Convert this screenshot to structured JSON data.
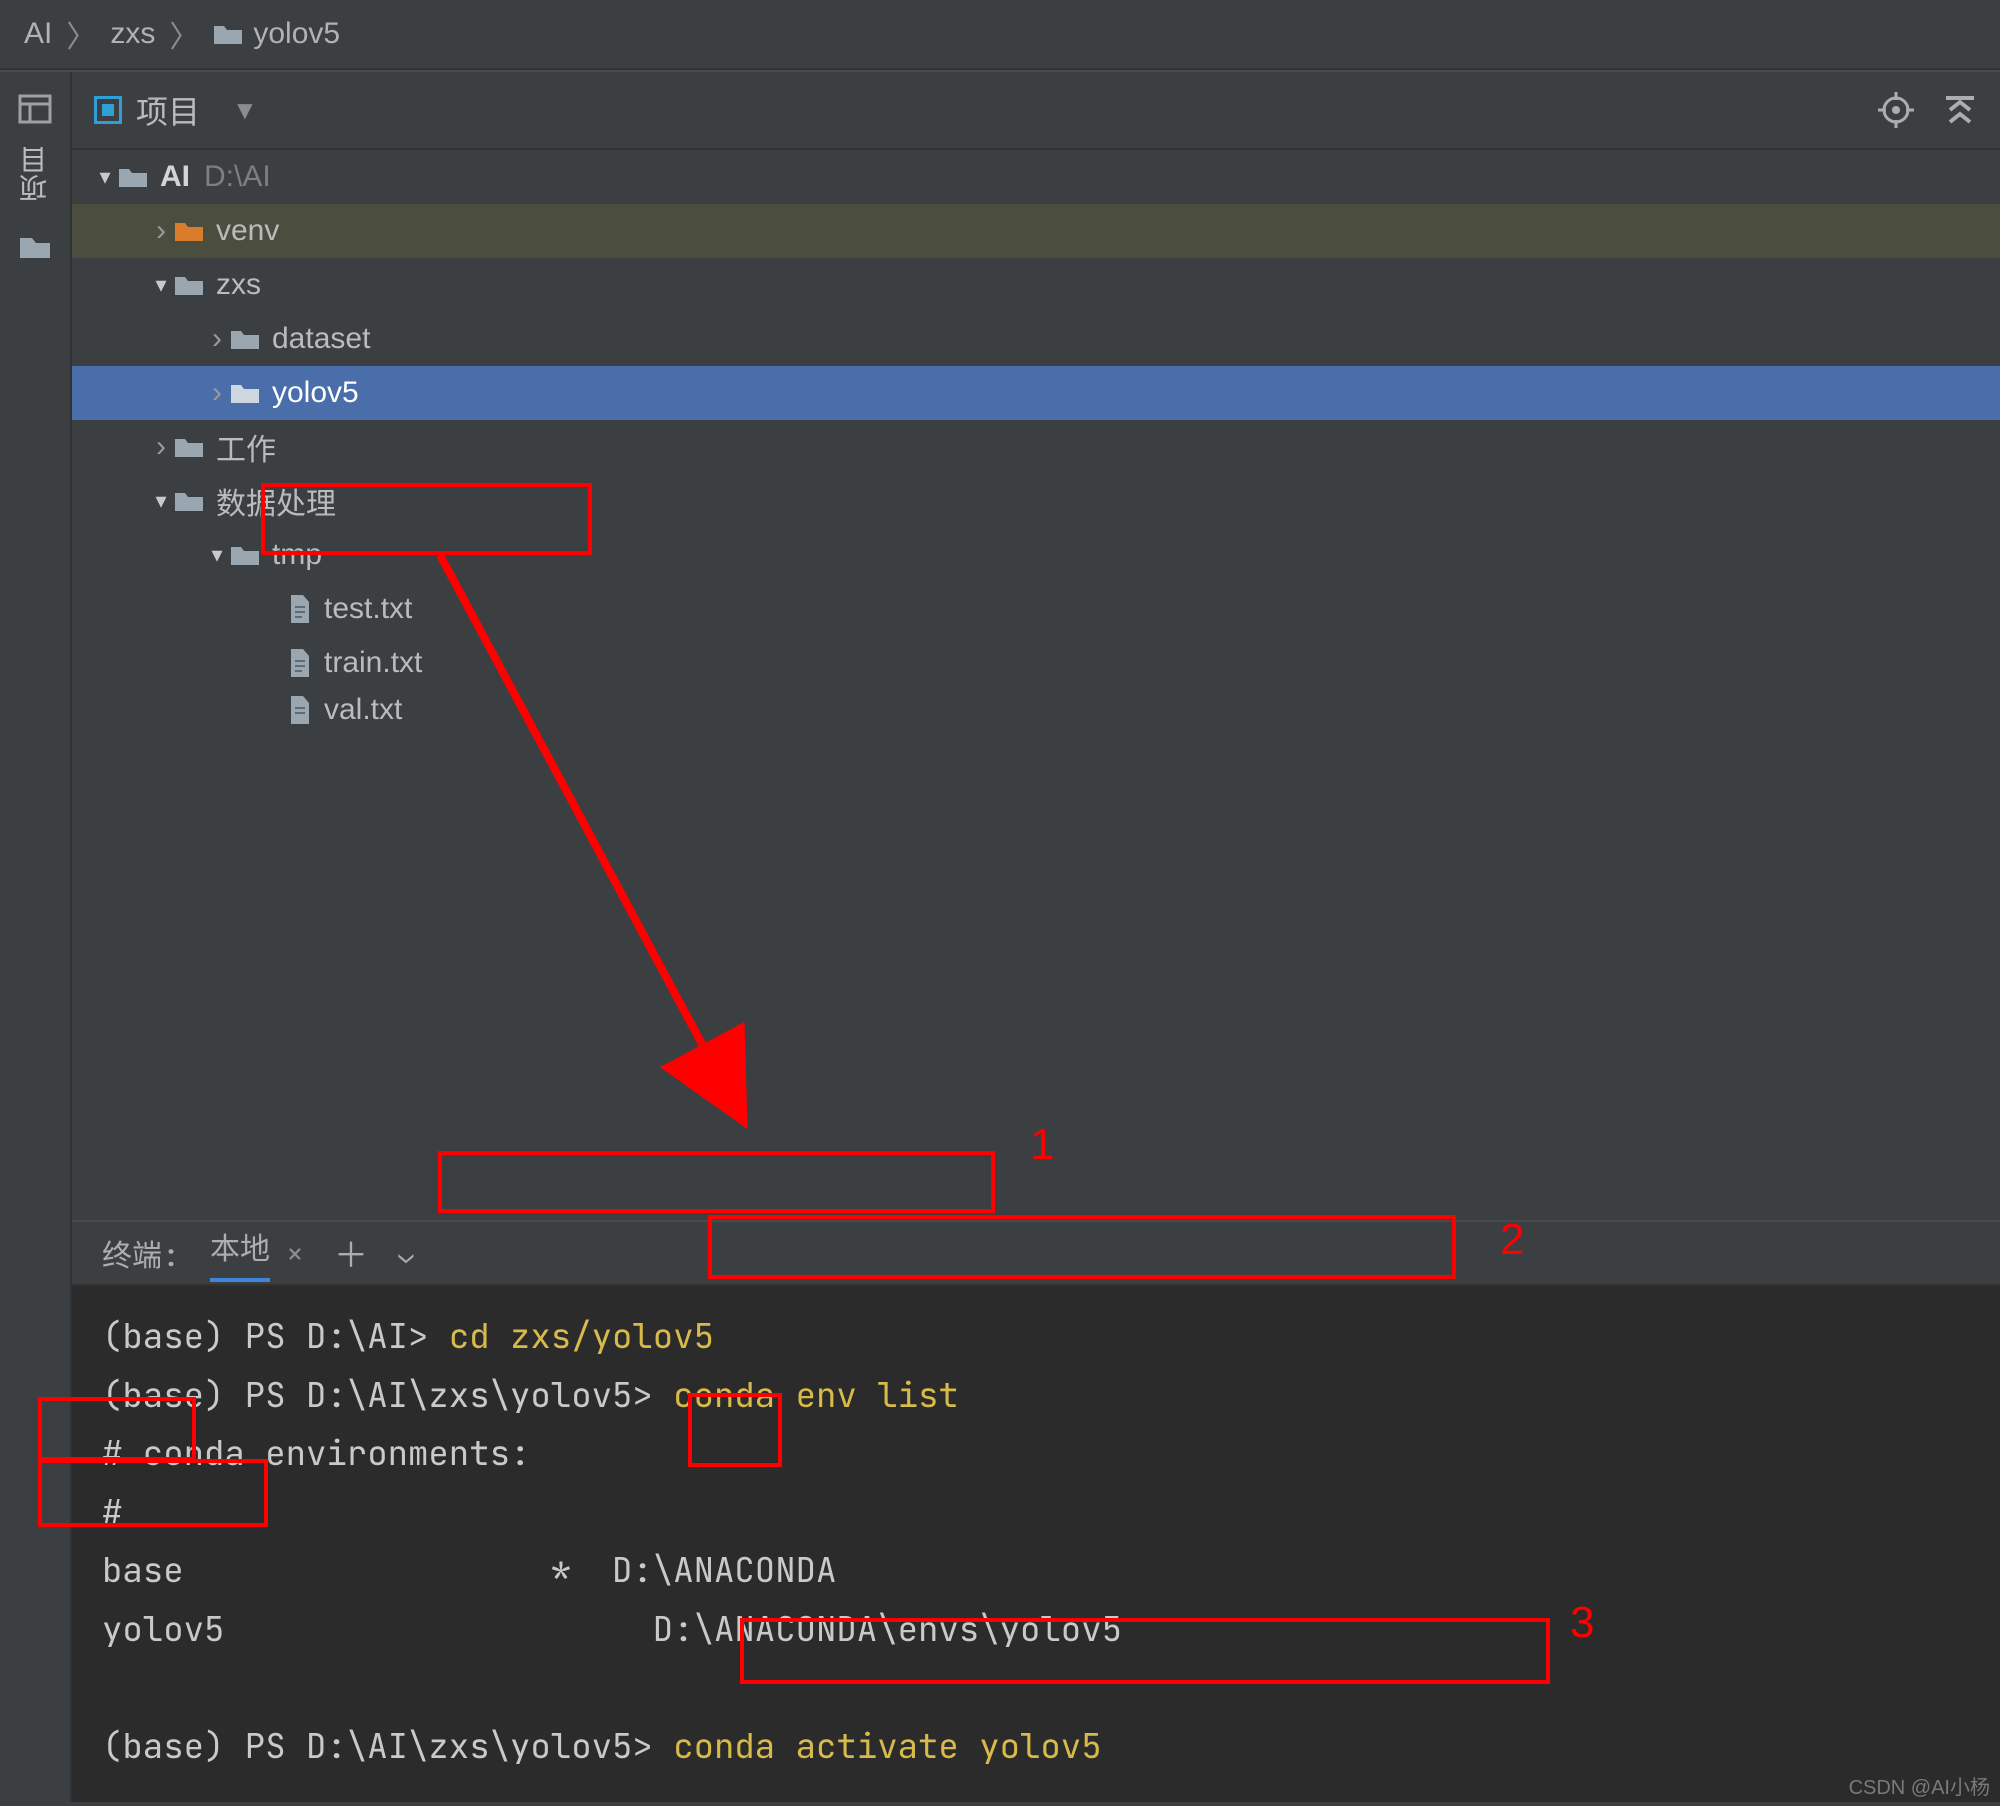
{
  "breadcrumb": {
    "item1": "AI",
    "item2": "zxs",
    "item3": "yolov5"
  },
  "gutter": {
    "label": "项目"
  },
  "project_panel": {
    "title": "项目",
    "toolbar": {
      "target_icon": "target-icon",
      "collapse_icon": "collapse-icon"
    }
  },
  "tree": {
    "root": {
      "name": "AI",
      "hint": "D:\\AI"
    },
    "venv": "venv",
    "zxs": "zxs",
    "dataset": "dataset",
    "yolov5": "yolov5",
    "work": "工作",
    "dataproc": "数据处理",
    "tmp": "tmp",
    "test": "test.txt",
    "train": "train.txt",
    "val": "val.txt"
  },
  "terminal": {
    "label": "终端:",
    "tab": "本地",
    "lines": {
      "l1a": "(base) PS D:\\AI> ",
      "l1b": "cd zxs/yolov5",
      "l2a": "(base) PS D:\\AI\\zxs\\yolov5> ",
      "l2b": "conda env list",
      "l3": "# conda environments:",
      "l4": "#",
      "l5a": "base",
      "l5b": "                  *  D:\\ANACONDA",
      "l6a": "yolov5",
      "l6b": "                     D:\\ANACONDA\\envs\\yolov5",
      "l7": "",
      "l8a": "(base) PS D:\\AI\\zxs\\yolov5> ",
      "l8b": "conda activate yolov5"
    }
  },
  "annotations": {
    "n1": "1",
    "n2": "2",
    "n3": "3"
  },
  "watermark": "CSDN @AI小杨"
}
